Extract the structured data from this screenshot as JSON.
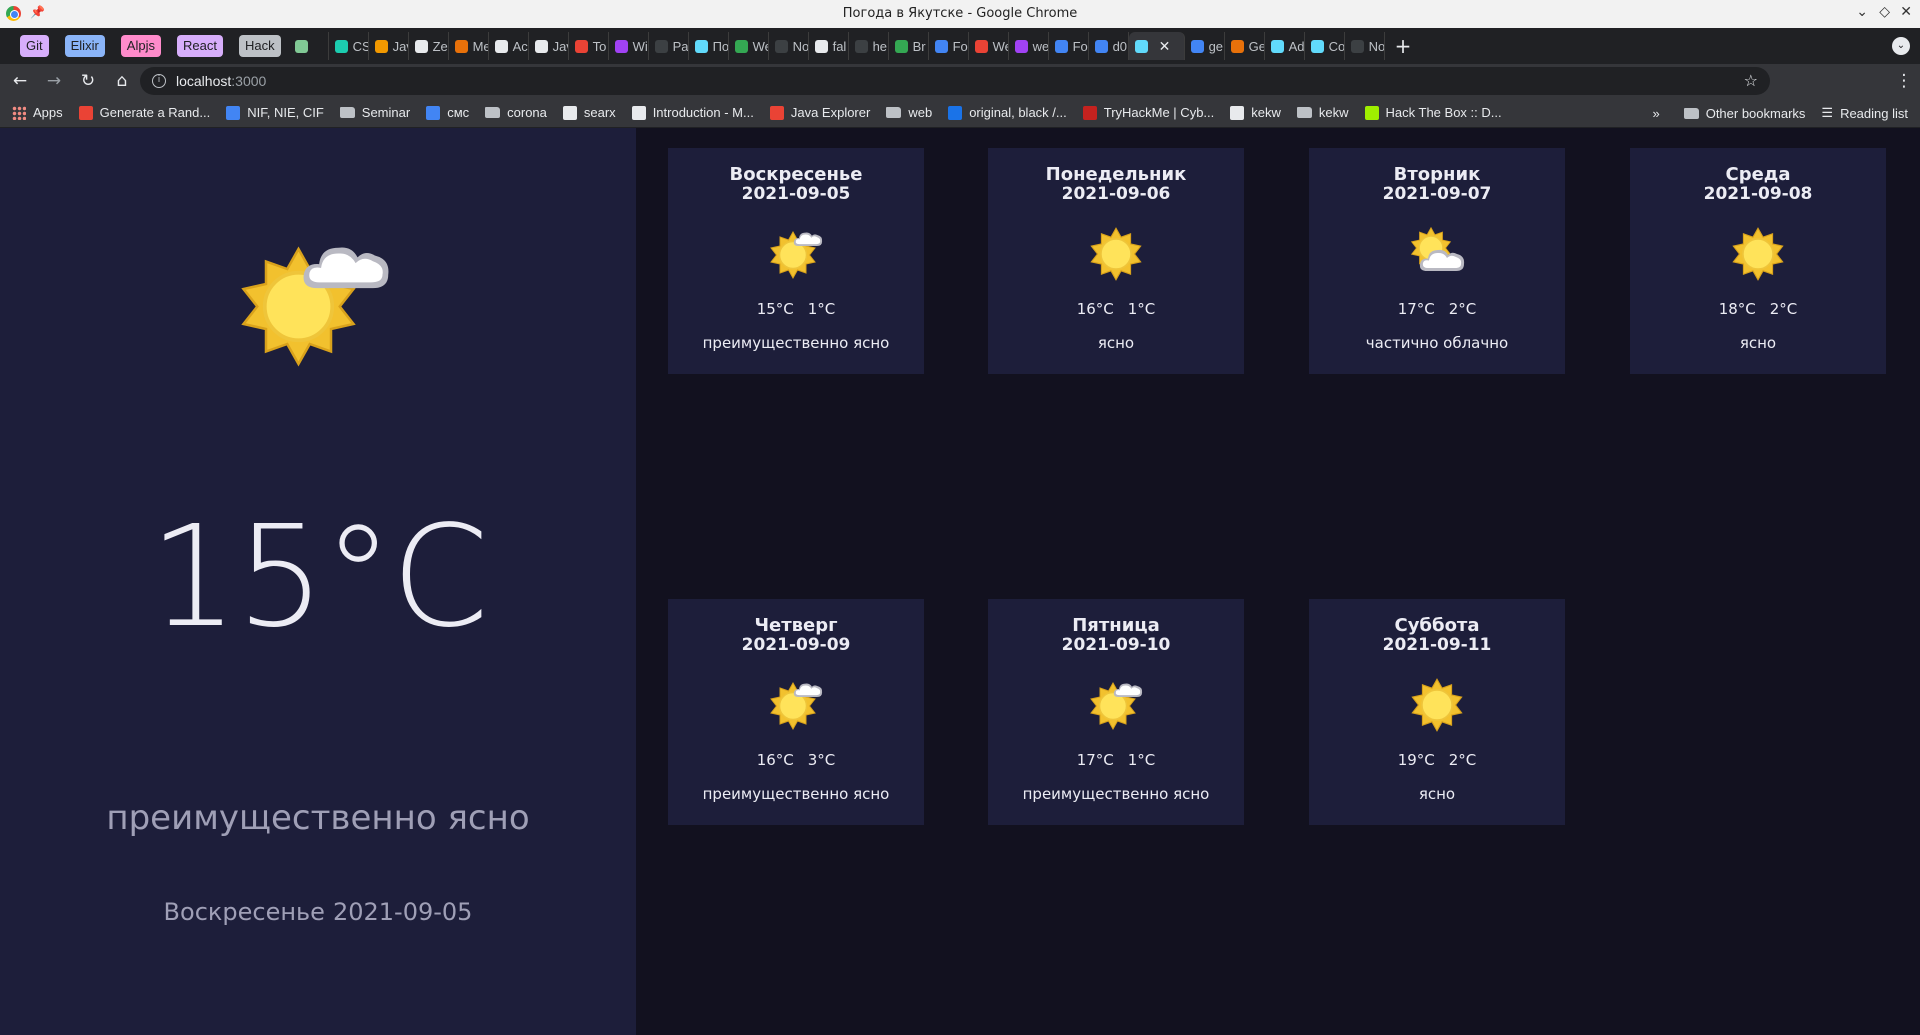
{
  "window": {
    "title": "Погода в Якутске - Google Chrome"
  },
  "tab_groups": [
    {
      "label": "Git",
      "color": "#d7aefb"
    },
    {
      "label": "Elixir",
      "color": "#8ab4f8"
    },
    {
      "label": "Alpjs",
      "color": "#ff8bcb"
    },
    {
      "label": "React",
      "color": "#d7aefb"
    },
    {
      "label": "Hack",
      "color": "#bdc1c6"
    }
  ],
  "tabs": [
    {
      "label": "",
      "color": "#81c995"
    },
    {
      "label": "CS",
      "color": "#1ccdb0"
    },
    {
      "label": "Jav",
      "color": "#f29900"
    },
    {
      "label": "Ze",
      "color": "#e8eaed"
    },
    {
      "label": "Me",
      "color": "#e8710a"
    },
    {
      "label": "Ac",
      "color": "#e8eaed"
    },
    {
      "label": "Jav",
      "color": "#e8eaed"
    },
    {
      "label": "To",
      "color": "#ea4335"
    },
    {
      "label": "Wi",
      "color": "#a142f4"
    },
    {
      "label": "Pa",
      "color": "#3c4043"
    },
    {
      "label": "По",
      "color": "#61dafb"
    },
    {
      "label": "We",
      "color": "#34a853"
    },
    {
      "label": "No",
      "color": "#3c4043"
    },
    {
      "label": "fal",
      "color": "#e8eaed"
    },
    {
      "label": "he",
      "color": "#3c4043"
    },
    {
      "label": "Br",
      "color": "#34a853"
    },
    {
      "label": "Fo",
      "color": "#4285f4"
    },
    {
      "label": "We",
      "color": "#ea4335"
    },
    {
      "label": "we",
      "color": "#a142f4"
    },
    {
      "label": "Fo",
      "color": "#4285f4"
    },
    {
      "label": "d0",
      "color": "#4285f4"
    }
  ],
  "active_tab": {
    "label": "",
    "color": "#61dafb"
  },
  "tabs_after": [
    {
      "label": "ge",
      "color": "#4285f4"
    },
    {
      "label": "Ge",
      "color": "#e8710a"
    },
    {
      "label": "Ad",
      "color": "#61dafb"
    },
    {
      "label": "Co",
      "color": "#61dafb"
    },
    {
      "label": "No",
      "color": "#3c4043"
    }
  ],
  "toolbar": {
    "url_host": "localhost",
    "url_port": ":3000"
  },
  "bookmarks": [
    {
      "label": "Apps",
      "kind": "apps"
    },
    {
      "label": "Generate a Rand...",
      "kind": "icon",
      "color": "#ea4335"
    },
    {
      "label": "NIF, NIE, CIF",
      "kind": "icon",
      "color": "#4285f4"
    },
    {
      "label": "Seminar",
      "kind": "folder"
    },
    {
      "label": "смс",
      "kind": "icon",
      "color": "#4285f4"
    },
    {
      "label": "corona",
      "kind": "folder"
    },
    {
      "label": "searx",
      "kind": "icon",
      "color": "#e8eaed"
    },
    {
      "label": "Introduction - M...",
      "kind": "icon",
      "color": "#e8eaed"
    },
    {
      "label": "Java Explorer",
      "kind": "icon",
      "color": "#ea4335"
    },
    {
      "label": "web",
      "kind": "folder"
    },
    {
      "label": "original, black /...",
      "kind": "icon",
      "color": "#1a73e8"
    },
    {
      "label": "TryHackMe | Cyb...",
      "kind": "icon",
      "color": "#c5221f"
    },
    {
      "label": "kekw",
      "kind": "icon",
      "color": "#e8eaed"
    },
    {
      "label": "kekw",
      "kind": "folder"
    },
    {
      "label": "Hack The Box :: D...",
      "kind": "icon",
      "color": "#9fef00"
    }
  ],
  "bookmarks_right": {
    "more": "»",
    "other": "Other bookmarks",
    "reading": "Reading list"
  },
  "today": {
    "icon": "partly-sunny-icon",
    "temperature": "15°C",
    "condition": "преимущественно ясно",
    "day": "Воскресенье",
    "date": "2021-09-05"
  },
  "forecast": [
    {
      "day": "Воскресенье",
      "date": "2021-09-05",
      "icon": "partly-sunny-icon",
      "high": "15°C",
      "low": "1°C",
      "condition": "преимущественно ясно"
    },
    {
      "day": "Понедельник",
      "date": "2021-09-06",
      "icon": "sun-icon",
      "high": "16°C",
      "low": "1°C",
      "condition": "ясно"
    },
    {
      "day": "Вторник",
      "date": "2021-09-07",
      "icon": "cloudy-sun-icon",
      "high": "17°C",
      "low": "2°C",
      "condition": "частично облачно"
    },
    {
      "day": "Среда",
      "date": "2021-09-08",
      "icon": "sun-icon",
      "high": "18°C",
      "low": "2°C",
      "condition": "ясно"
    },
    {
      "day": "Четверг",
      "date": "2021-09-09",
      "icon": "partly-sunny-icon",
      "high": "16°C",
      "low": "3°C",
      "condition": "преимущественно ясно"
    },
    {
      "day": "Пятница",
      "date": "2021-09-10",
      "icon": "partly-sunny-icon",
      "high": "17°C",
      "low": "1°C",
      "condition": "преимущественно ясно"
    },
    {
      "day": "Суббота",
      "date": "2021-09-11",
      "icon": "sun-icon",
      "high": "19°C",
      "low": "2°C",
      "condition": "ясно"
    }
  ]
}
